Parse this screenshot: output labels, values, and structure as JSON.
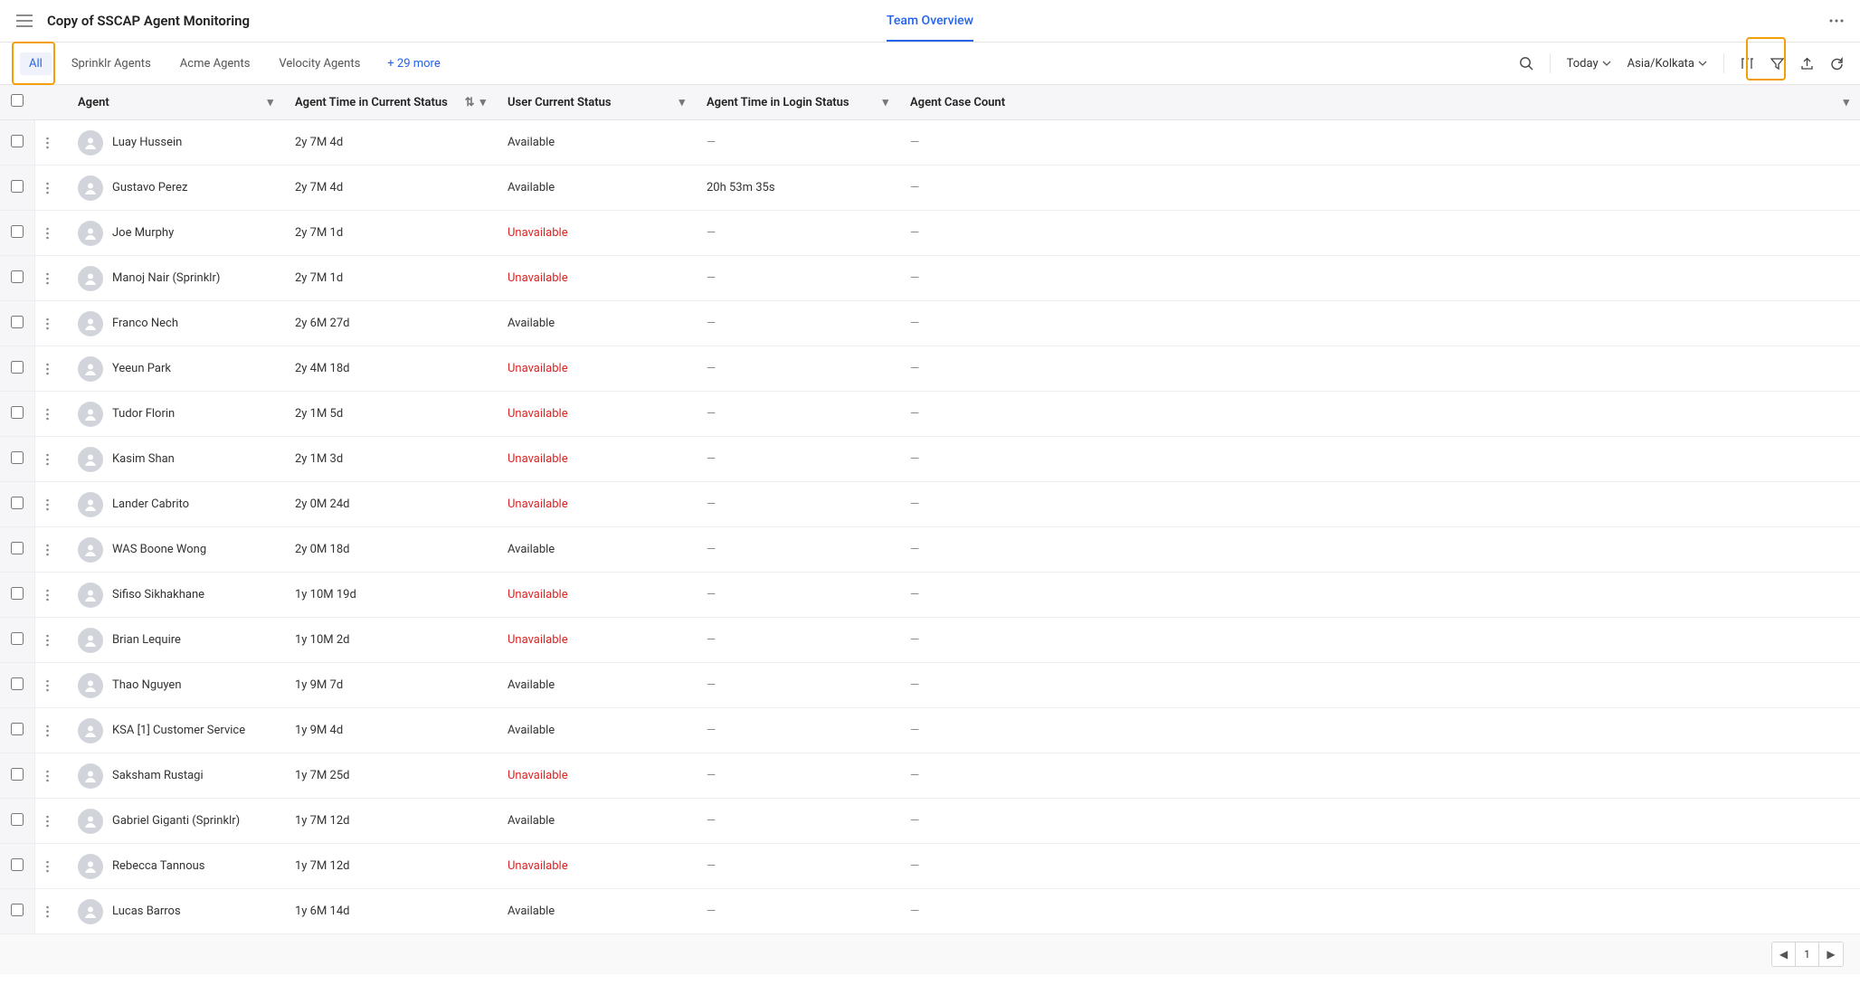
{
  "header": {
    "title": "Copy of SSCAP Agent Monitoring",
    "center_tab": "Team Overview"
  },
  "toolbar": {
    "tabs": [
      "All",
      "Sprinklr Agents",
      "Acme Agents",
      "Velocity Agents"
    ],
    "more_link": "+ 29 more",
    "date_label": "Today",
    "timezone": "Asia/Kolkata"
  },
  "columns": {
    "agent": "Agent",
    "time_status": "Agent Time in Current Status",
    "user_status": "User Current Status",
    "login_status": "Agent Time in Login Status",
    "case_count": "Agent Case Count"
  },
  "rows": [
    {
      "agent": "Luay Hussein",
      "time": "2y 7M 4d",
      "status": "Available",
      "login": "—",
      "cases": "—"
    },
    {
      "agent": "Gustavo Perez",
      "time": "2y 7M 4d",
      "status": "Available",
      "login": "20h 53m 35s",
      "cases": "—"
    },
    {
      "agent": "Joe Murphy",
      "time": "2y 7M 1d",
      "status": "Unavailable",
      "login": "—",
      "cases": "—"
    },
    {
      "agent": "Manoj Nair (Sprinklr)",
      "time": "2y 7M 1d",
      "status": "Unavailable",
      "login": "—",
      "cases": "—"
    },
    {
      "agent": "Franco Nech",
      "time": "2y 6M 27d",
      "status": "Available",
      "login": "—",
      "cases": "—"
    },
    {
      "agent": "Yeeun Park",
      "time": "2y 4M 18d",
      "status": "Unavailable",
      "login": "—",
      "cases": "—"
    },
    {
      "agent": "Tudor Florin",
      "time": "2y 1M 5d",
      "status": "Unavailable",
      "login": "—",
      "cases": "—"
    },
    {
      "agent": "Kasim Shan",
      "time": "2y 1M 3d",
      "status": "Unavailable",
      "login": "—",
      "cases": "—"
    },
    {
      "agent": "Lander Cabrito",
      "time": "2y 0M 24d",
      "status": "Unavailable",
      "login": "—",
      "cases": "—"
    },
    {
      "agent": "WAS Boone Wong",
      "time": "2y 0M 18d",
      "status": "Available",
      "login": "—",
      "cases": "—"
    },
    {
      "agent": "Sifiso Sikhakhane",
      "time": "1y 10M 19d",
      "status": "Unavailable",
      "login": "—",
      "cases": "—"
    },
    {
      "agent": "Brian Lequire",
      "time": "1y 10M 2d",
      "status": "Unavailable",
      "login": "—",
      "cases": "—"
    },
    {
      "agent": "Thao Nguyen",
      "time": "1y 9M 7d",
      "status": "Available",
      "login": "—",
      "cases": "—"
    },
    {
      "agent": "KSA [1] Customer Service",
      "time": "1y 9M 4d",
      "status": "Available",
      "login": "—",
      "cases": "—"
    },
    {
      "agent": "Saksham Rustagi",
      "time": "1y 7M 25d",
      "status": "Unavailable",
      "login": "—",
      "cases": "—"
    },
    {
      "agent": "Gabriel Giganti (Sprinklr)",
      "time": "1y 7M 12d",
      "status": "Available",
      "login": "—",
      "cases": "—"
    },
    {
      "agent": "Rebecca Tannous",
      "time": "1y 7M 12d",
      "status": "Unavailable",
      "login": "—",
      "cases": "—"
    },
    {
      "agent": "Lucas Barros",
      "time": "1y 6M 14d",
      "status": "Available",
      "login": "—",
      "cases": "—"
    }
  ],
  "pagination": {
    "current": "1"
  }
}
